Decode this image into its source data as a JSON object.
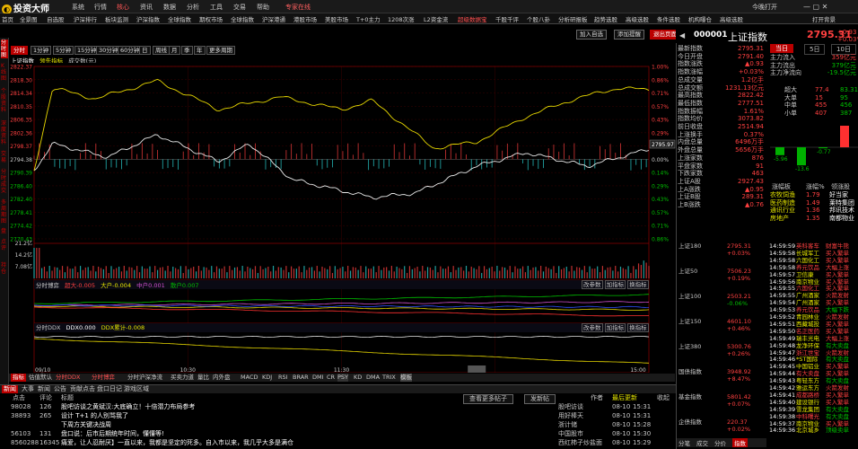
{
  "app": {
    "title": "投资大师",
    "menus": [
      "系统",
      "行情",
      "核心",
      "资讯",
      "数据",
      "分析",
      "工具",
      "交易",
      "帮助"
    ],
    "rec_label": "专家在线",
    "time": "今晚打开",
    "tf": "打开背景"
  },
  "nav": {
    "items": [
      "首页",
      "全景图",
      "自选股",
      "沪深排行",
      "板块监测",
      "沪深指数",
      "全球指数",
      "期权市场",
      "全球指数",
      "沪深港通",
      "港股市场",
      "美股市场",
      "T+0主力",
      "1208次涨",
      "L2资金流",
      "超级数据宝",
      "千股千评",
      "个股八卦",
      "分析研报板",
      "趋势选股",
      "高级选股",
      "条件选股",
      "机构曝仓",
      "高级选股"
    ],
    "right": "打开背景"
  },
  "left_tabs": [
    "分时图",
    "K线图",
    "个股资料",
    "深度资料",
    "交易",
    "分时成交",
    "多周期图",
    "盘",
    "点评",
    "持仓"
  ],
  "periods": [
    "分时",
    "1分钟",
    "5分钟",
    "15分钟",
    "30分钟",
    "60分钟",
    "日",
    "周线",
    "月",
    "季",
    "年",
    "更多周期"
  ],
  "chart_meta": {
    "name": "上证指数",
    "ma_label": "领先指标",
    "vol_label": "成交数(元)"
  },
  "buttons": {
    "add_self": "加入自选",
    "add_alert": "添加提醒",
    "exit": "退出页面"
  },
  "quote": {
    "code": "000001",
    "name": "上证指数",
    "price": "2795.31",
    "change": "+0.93",
    "pct": "+0.03%",
    "tabs": [
      "当日",
      "5日",
      "10日"
    ]
  },
  "stats": [
    {
      "k": "最新指数",
      "v": "2795.31",
      "c": "red"
    },
    {
      "k": "今日开盘",
      "v": "2791.40",
      "c": "red"
    },
    {
      "k": "指数涨跌",
      "v": "▲0.93",
      "c": "red"
    },
    {
      "k": "指数涨幅",
      "v": "+0.03%",
      "c": "red"
    },
    {
      "k": "总成交量",
      "v": "1.2亿手",
      "c": "yel"
    },
    {
      "k": "总成交额",
      "v": "1231.13亿元",
      "c": "cyan"
    },
    {
      "k": "最高指数",
      "v": "2822.42",
      "c": "red"
    },
    {
      "k": "最低指数",
      "v": "2777.51",
      "c": "grn"
    },
    {
      "k": "指数振幅",
      "v": "1.61%",
      "c": "wht"
    },
    {
      "k": "指数均价",
      "v": "3073.82",
      "c": "red"
    },
    {
      "k": "前日收盘",
      "v": "2514.94",
      "c": "wht"
    },
    {
      "k": "上涨换手",
      "v": "0.37%",
      "c": "wht"
    },
    {
      "k": "内盘总量",
      "v": "6496万手",
      "c": "grn"
    },
    {
      "k": "外盘总量",
      "v": "5656万手",
      "c": "red"
    },
    {
      "k": "上涨家数",
      "v": "876",
      "c": "red"
    },
    {
      "k": "平盘家数",
      "v": "91",
      "c": "wht"
    },
    {
      "k": "下跌家数",
      "v": "463",
      "c": "grn"
    },
    {
      "k": "上证A股",
      "v": "2927.43",
      "c": "red"
    },
    {
      "k": "上A涨跌",
      "v": "▲0.95",
      "c": "red"
    },
    {
      "k": "上证B股",
      "v": "289.31",
      "c": "red"
    },
    {
      "k": "上B涨跌",
      "v": "▲0.76",
      "c": "red"
    }
  ],
  "flows": {
    "tabs": [
      "当日",
      "5日",
      "10日"
    ],
    "items": [
      {
        "k": "主力流入",
        "v": "359亿元",
        "c": "red"
      },
      {
        "k": "主力流出",
        "v": "379亿元",
        "c": "grn"
      },
      {
        "k": "主力净流向",
        "v": "-19.5亿元",
        "c": "grn"
      }
    ],
    "hdr": [
      "超大",
      "大单",
      "中单",
      "小单"
    ],
    "a": [
      "77.4",
      "15",
      "455",
      "407"
    ],
    "b": [
      "83.31",
      "95",
      "456",
      "387"
    ],
    "bars": [
      {
        "v": "-5.96",
        "c": "grn"
      },
      {
        "v": "-13.6",
        "c": "grn"
      },
      {
        "v": "-0.77",
        "c": "grn"
      },
      {
        "v": "20.3",
        "c": "red"
      }
    ]
  },
  "sectors": {
    "hdr": [
      "涨幅板",
      "涨幅%",
      "领涨股"
    ],
    "rows": [
      [
        "农牧饲渔",
        "1.79",
        "好当家"
      ],
      [
        "医药制造",
        "1.49",
        "莱特集团"
      ],
      [
        "通讯行业",
        "1.36",
        "邦讯技术"
      ],
      [
        "房地产",
        "1.35",
        "南都物业"
      ]
    ]
  },
  "index_list": [
    {
      "name": "上证180",
      "v": "2795.31",
      "p": "+0.03%"
    },
    {
      "name": "上证50",
      "v": "7506.23",
      "p": "+0.19%"
    },
    {
      "name": "上证100",
      "v": "2503.21",
      "p": "-0.06%"
    },
    {
      "name": "上证150",
      "v": "4601.10",
      "p": "+0.46%"
    },
    {
      "name": "上证380",
      "v": "5300.76",
      "p": "+0.26%"
    },
    {
      "name": "国债指数",
      "v": "3948.92",
      "p": "+8.47%"
    },
    {
      "name": "基金指数",
      "v": "5801.42",
      "p": "+0.07%"
    },
    {
      "name": "企债指数",
      "v": "220.37",
      "p": "+0.02%"
    }
  ],
  "ticks": [
    [
      "14:59:59",
      "大众",
      "英科客车",
      "财富牛熊"
    ],
    [
      "14:59:58",
      "万科",
      "长城军工",
      "买入繁单"
    ],
    [
      "14:59:58",
      "九为",
      "六国化工",
      "买入繁单"
    ],
    [
      "14:59:58",
      "易达",
      "养元饮品",
      "大幅上涨"
    ],
    [
      "14:59:57",
      "南风",
      "卫信康",
      "买入繁单"
    ],
    [
      "14:59:56",
      "方大",
      "南京物业",
      "买入繁单"
    ],
    [
      "14:59:55",
      "九为",
      "六国化工",
      "买入繁单"
    ],
    [
      "14:59:55",
      "康达",
      "广州酒家",
      "火箭发射"
    ],
    [
      "14:59:54",
      "盛泰",
      "广州酒家",
      "买入繁单"
    ],
    [
      "14:59:53",
      "三秦",
      "养元饮品",
      "大幅下跌"
    ],
    [
      "14:59:52",
      "双良",
      "青园林业",
      "火箭发射"
    ],
    [
      "14:59:51",
      "光诚",
      "西藏城投",
      "买入繁单"
    ],
    [
      "14:59:50",
      "恒立",
      "名正医药",
      "买入繁单"
    ],
    [
      "14:59:49",
      "中力",
      "瑞丰光电",
      "大幅上涨"
    ],
    [
      "14:59:48",
      "正泰",
      "龙净环保",
      "有大卖盘"
    ],
    [
      "14:59:47",
      "长源",
      "浙江世宝",
      "火箭发射"
    ],
    [
      "14:59:46",
      "和顺",
      "*ST国际",
      "有大卖盘"
    ],
    [
      "14:59:45",
      "东南",
      "中国铝业",
      "买入繁单"
    ],
    [
      "14:59:44",
      "九为",
      "有大卖盘",
      "买入繁单"
    ],
    [
      "14:59:43",
      "海航",
      "粤轻东方",
      "有大卖盘"
    ],
    [
      "14:59:42",
      "中铁",
      "雅运东方",
      "火箭发射"
    ],
    [
      "14:59:41",
      "三泰",
      "成都路桥",
      "买入繁单"
    ],
    [
      "14:59:40",
      "兴业",
      "建设银行",
      "买入繁单"
    ],
    [
      "14:59:39",
      "中原",
      "雪龙集团",
      "有大卖盘"
    ],
    [
      "14:59:38",
      "华联",
      "中科曙光",
      "有大卖盘"
    ],
    [
      "14:59:37",
      "南方",
      "南京物业",
      "买入繁单"
    ],
    [
      "14:59:36",
      "北京",
      "北京城乡",
      "顶级卖单"
    ]
  ],
  "rbottom": [
    "分笔",
    "成交",
    "分价",
    "指数"
  ],
  "price_axis": [
    "2822.37",
    "2818.30",
    "2814.34",
    "2810.35",
    "2806.35",
    "2802.36",
    "2798.37",
    "2794.38",
    "2790.39",
    "2786.40",
    "2782.40",
    "2778.41",
    "2774.42",
    "2770.43"
  ],
  "pct_axis": [
    "1.00%",
    "0.86%",
    "0.71%",
    "0.57%",
    "0.43%",
    "0.29%",
    "0.14%",
    "0.00%",
    "0.14%",
    "0.29%",
    "0.43%",
    "0.57%",
    "0.71%",
    "0.86%"
  ],
  "last_label": "2795.97",
  "vol_axis": [
    "21.2亿",
    "14.2亿",
    "7.08亿"
  ],
  "flow1": {
    "title": "分时博弈",
    "items": [
      "超大-0.005",
      "大户-0.004",
      "中户0.001",
      "散户0.007"
    ],
    "btns": [
      "改参数",
      "加指标",
      "换指标"
    ]
  },
  "flow2": {
    "title": "分时DDX",
    "items": [
      "DDX0.000",
      "DDX累计-0.008"
    ],
    "btns": [
      "改参数",
      "加指标",
      "换指标"
    ]
  },
  "time_axis": [
    "09/10",
    "10:30",
    "11:30",
    "13:52",
    "15:00"
  ],
  "itabs": [
    "指标",
    "估值默认",
    "分时DDX",
    "分时博弈",
    "分时沪深净流",
    "买卖力道",
    "量比",
    "内外盘",
    "MACD",
    "KDJ",
    "RSI",
    "BRAR",
    "DMI",
    "CR",
    "PSY",
    "KD",
    "DMA",
    "TRIX",
    "模板"
  ],
  "btabs": [
    "新闻",
    "大事",
    "新闻",
    "公告",
    "贡献点击",
    "盘口日记",
    "游戏区域"
  ],
  "bcols": [
    "点击",
    "评论",
    "标题",
    "作者",
    "最后更新",
    "收起"
  ],
  "news": [
    {
      "a": "98028",
      "b": "126",
      "t": "股吧访谈之黄斌汉:大底确立！十倍潜力布局参考",
      "au": "股吧访谈",
      "d": "08-10",
      "tm": "15:31"
    },
    {
      "a": "38893",
      "b": "265",
      "t": "设计 T+1 的人别骂我了",
      "au": "用好棒天",
      "d": "08-10",
      "tm": "15:31"
    },
    {
      "a": "",
      "b": "",
      "t": "下周方关键决战周",
      "au": "浙计储",
      "d": "08-10",
      "tm": "15:28"
    },
    {
      "a": "56103",
      "b": "131",
      "t": "盘口说：后市后期统年时间，懂懂等!",
      "au": "中国股市",
      "d": "08-10",
      "tm": "15:30"
    },
    {
      "a": "8560288",
      "b": "16345",
      "t": "痛爱，让人忍耐厌】一直以来，我都是坚定的死多。自入市以来，我几乎大多是满仓",
      "au": "西红柿子炒盐面",
      "d": "08-10",
      "tm": "15:29"
    }
  ],
  "news_btns": [
    "查看更多帖子",
    "发新帖"
  ]
}
